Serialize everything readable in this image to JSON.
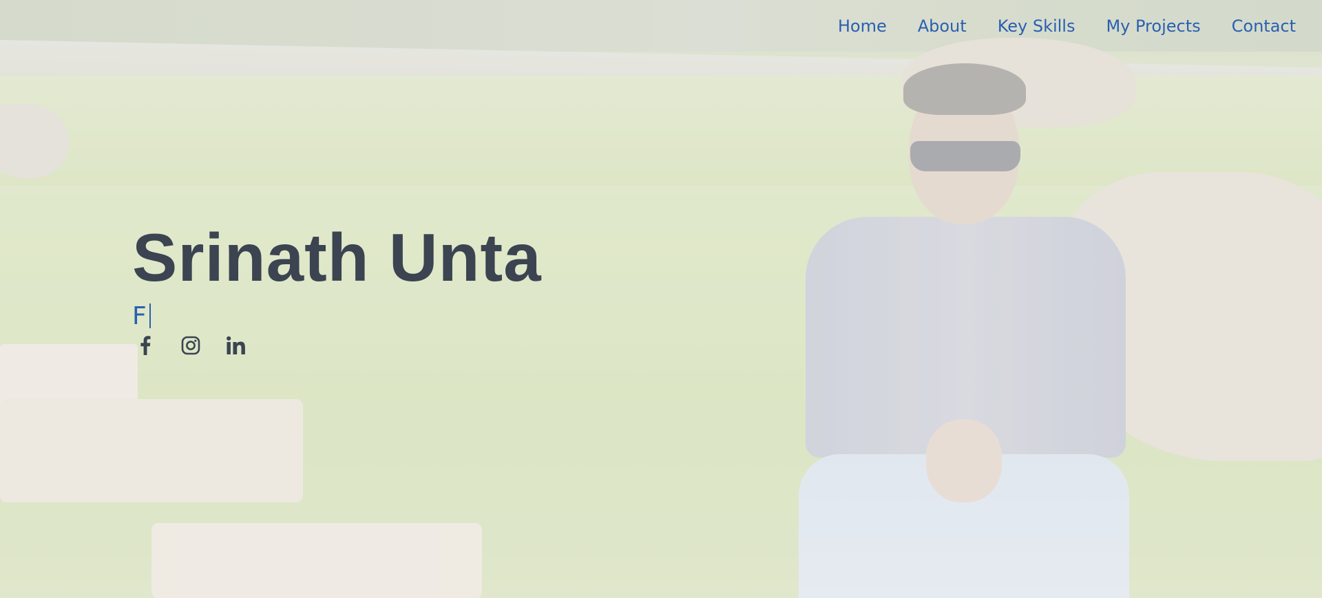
{
  "nav": {
    "items": [
      {
        "label": "Home"
      },
      {
        "label": "About"
      },
      {
        "label": "Key Skills"
      },
      {
        "label": "My Projects"
      },
      {
        "label": "Contact"
      }
    ]
  },
  "hero": {
    "name": "Srinath Unta",
    "typed_text": "F",
    "socials": [
      {
        "icon": "facebook-icon"
      },
      {
        "icon": "instagram-icon"
      },
      {
        "icon": "linkedin-icon"
      }
    ]
  },
  "colors": {
    "accent": "#2a5fb0",
    "heading": "#3b4450",
    "icon": "#3b4450"
  }
}
